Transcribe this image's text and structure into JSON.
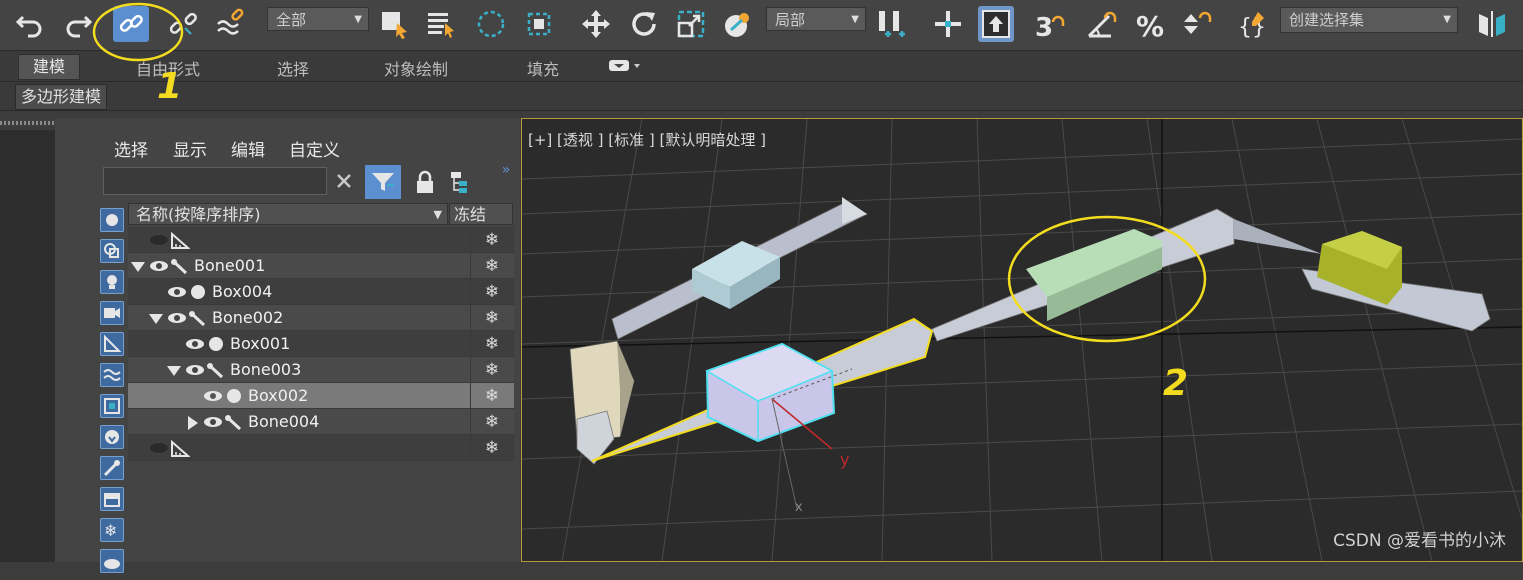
{
  "toolbar": {
    "selection_filter": "全部",
    "coordinate_system": "局部",
    "named_selection_placeholder": "创建选择集",
    "icons": [
      "undo-icon",
      "redo-icon",
      "select-and-link-icon",
      "unlink-icon",
      "bind-to-space-warp-icon",
      "select-object-icon",
      "select-by-name-icon",
      "rectangular-selection-icon",
      "window-crossing-icon",
      "select-and-move-icon",
      "select-and-rotate-icon",
      "select-and-scale-icon",
      "select-manipulate-icon",
      "snap-3d-icon",
      "angle-snap-icon",
      "percent-snap-icon",
      "spinner-snap-icon",
      "edit-named-selection-icon",
      "mirror-icon"
    ]
  },
  "ribbon": {
    "tabs": [
      "建模",
      "自由形式",
      "选择",
      "对象绘制",
      "填充"
    ],
    "selected_tab": "建模",
    "sub_tab": "多边形建模"
  },
  "scene_explorer": {
    "menu": [
      "选择",
      "显示",
      "编辑",
      "自定义"
    ],
    "search_value": "",
    "column_name": "名称(按降序排序)",
    "column_freeze": "冻结",
    "rows": [
      {
        "name": "",
        "type": "bone-helper"
      },
      {
        "name": "Bone001",
        "type": "bone"
      },
      {
        "name": "Box004",
        "type": "geometry"
      },
      {
        "name": "Bone002",
        "type": "bone"
      },
      {
        "name": "Box001",
        "type": "geometry"
      },
      {
        "name": "Bone003",
        "type": "bone"
      },
      {
        "name": "Box002",
        "type": "geometry",
        "selected": true
      },
      {
        "name": "Bone004",
        "type": "bone"
      },
      {
        "name": "",
        "type": "bone-helper"
      }
    ],
    "freeze_symbol": "❄"
  },
  "viewport": {
    "label": "[+] [透视 ] [标准 ] [默认明暗处理 ]",
    "axis_y": "y",
    "axis_x": "x"
  },
  "annotations": {
    "marker1": "1",
    "marker2": "2"
  },
  "watermark": "CSDN @爱看书的小沐",
  "colors": {
    "accent": "#5b8fd0",
    "highlight": "#f3dc1f",
    "selection_frame": "#b49b3c"
  }
}
